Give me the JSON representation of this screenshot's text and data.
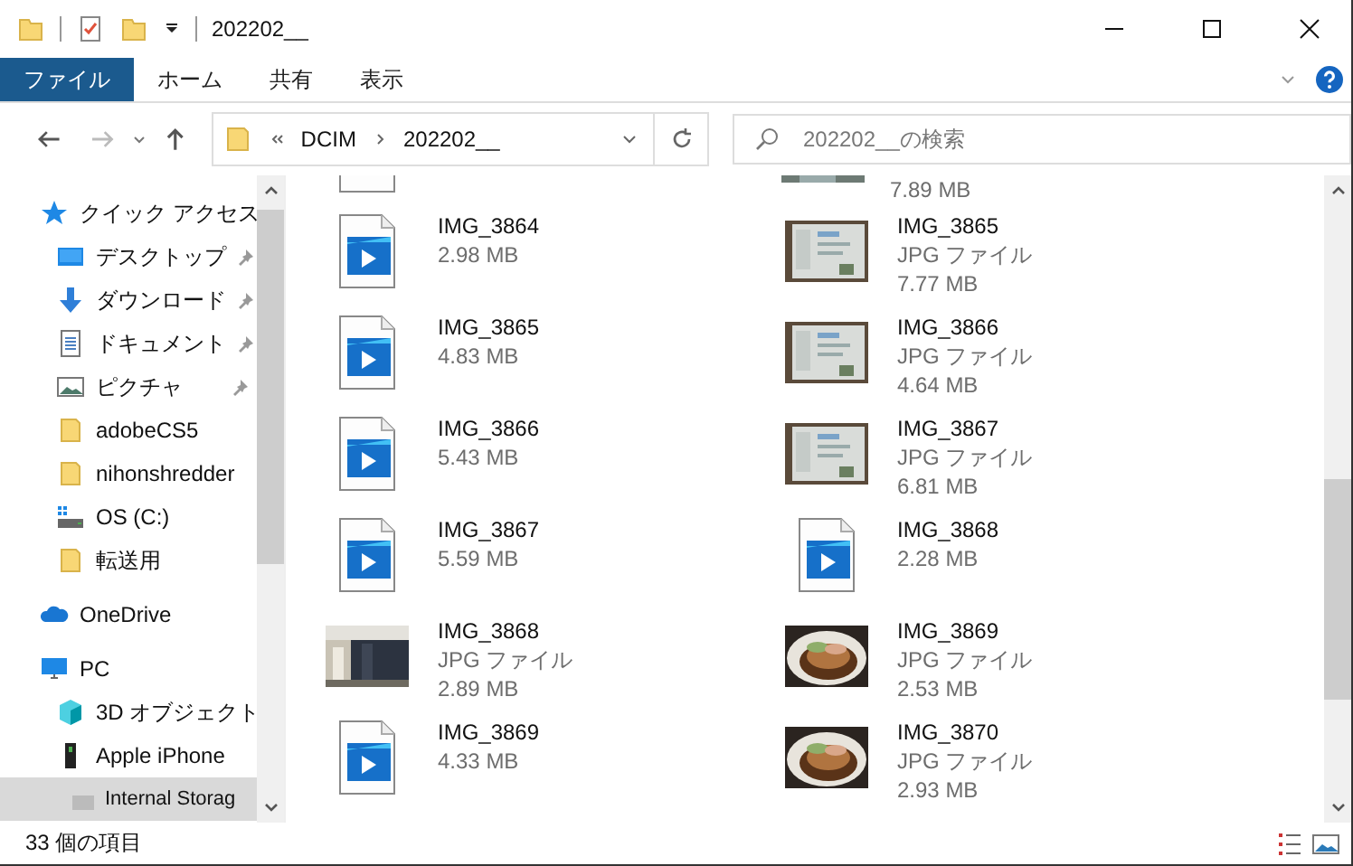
{
  "window": {
    "title": "202202__"
  },
  "ribbon": {
    "tabs": [
      {
        "label": "ファイル",
        "selected": true
      },
      {
        "label": "ホーム",
        "selected": false
      },
      {
        "label": "共有",
        "selected": false
      },
      {
        "label": "表示",
        "selected": false
      }
    ]
  },
  "address": {
    "crumbs": [
      "DCIM",
      "202202__"
    ]
  },
  "search": {
    "placeholder": "202202__の検索"
  },
  "sidebar": {
    "items": [
      {
        "label": "クイック アクセス",
        "kind": "star",
        "selected": false,
        "children": [
          {
            "label": "デスクトップ",
            "kind": "desktop",
            "pinned": true,
            "selected": false
          },
          {
            "label": "ダウンロード",
            "kind": "download",
            "pinned": true,
            "selected": false
          },
          {
            "label": "ドキュメント",
            "kind": "document",
            "pinned": true,
            "selected": false
          },
          {
            "label": "ピクチャ",
            "kind": "pictures",
            "pinned": true,
            "selected": false
          },
          {
            "label": "adobeCS5",
            "kind": "folder",
            "pinned": false,
            "selected": false
          },
          {
            "label": "nihonshredder",
            "kind": "folder",
            "pinned": false,
            "selected": false
          },
          {
            "label": "OS (C:)",
            "kind": "drive",
            "pinned": false,
            "selected": false
          },
          {
            "label": "転送用",
            "kind": "folder",
            "pinned": false,
            "selected": false
          }
        ]
      },
      {
        "label": "OneDrive",
        "kind": "cloud",
        "selected": false
      },
      {
        "label": "PC",
        "kind": "pc",
        "selected": false,
        "children": [
          {
            "label": "3D オブジェクト",
            "kind": "cube",
            "selected": false
          },
          {
            "label": "Apple iPhone",
            "kind": "phone",
            "selected": false,
            "children": [
              {
                "label": "Internal Storag",
                "kind": "storage",
                "selected": true
              }
            ]
          }
        ]
      }
    ]
  },
  "partial_row": {
    "size": "7.89 MB"
  },
  "files": [
    {
      "kind": "video",
      "name": "IMG_3864",
      "size": "2.98 MB"
    },
    {
      "name": "IMG_3865",
      "type": "JPG ファイル",
      "size": "7.77 MB"
    },
    {
      "kind": "video",
      "name": "IMG_3865",
      "size": "4.83 MB"
    },
    {
      "name": "IMG_3866",
      "type": "JPG ファイル",
      "size": "4.64 MB"
    },
    {
      "kind": "video",
      "name": "IMG_3866",
      "size": "5.43 MB"
    },
    {
      "name": "IMG_3867",
      "type": "JPG ファイル",
      "size": "6.81 MB"
    },
    {
      "kind": "video",
      "name": "IMG_3867",
      "size": "5.59 MB"
    },
    {
      "kind": "video",
      "name": "IMG_3868",
      "size": "2.28 MB"
    },
    {
      "name": "IMG_3868",
      "type": "JPG ファイル",
      "size": "2.89 MB"
    },
    {
      "name": "IMG_3869",
      "type": "JPG ファイル",
      "size": "2.53 MB"
    },
    {
      "kind": "video",
      "name": "IMG_3869",
      "size": "4.33 MB"
    },
    {
      "name": "IMG_3870",
      "type": "JPG ファイル",
      "size": "2.93 MB"
    }
  ],
  "status_bar": {
    "count": "33 個の項目"
  }
}
